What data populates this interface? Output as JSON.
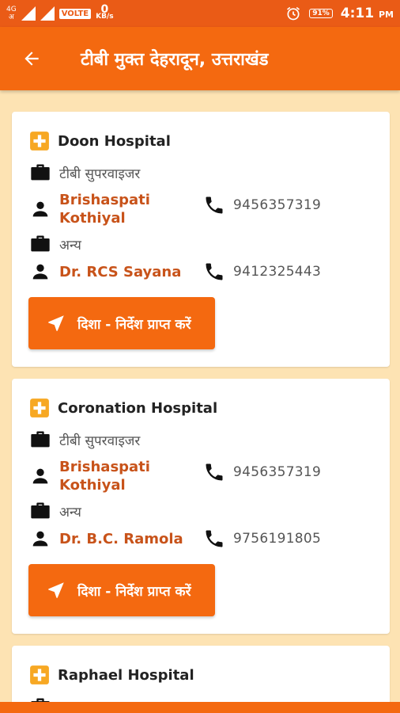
{
  "status_bar": {
    "network": "4G",
    "network_sub": "अ",
    "volte": "VOLTE",
    "data_speed": "0",
    "data_unit": "KB/s",
    "battery": "91%",
    "time": "4:11",
    "ampm": "PM"
  },
  "header": {
    "title": "टीबी मुक्त देहरादून, उत्तराखंड"
  },
  "hospitals": [
    {
      "name": "Doon Hospital",
      "role1": "टीबी सुपरवाइजर",
      "contact1_name": "Brishaspati Kothiyal",
      "contact1_phone": "9456357319",
      "role2": "अन्य",
      "contact2_name": "Dr. RCS Sayana",
      "contact2_phone": "9412325443",
      "button_label": "दिशा - निर्देश प्राप्त करें"
    },
    {
      "name": "Coronation Hospital",
      "role1": "टीबी सुपरवाइजर",
      "contact1_name": "Brishaspati Kothiyal",
      "contact1_phone": "9456357319",
      "role2": "अन्य",
      "contact2_name": "Dr. B.C. Ramola",
      "contact2_phone": "9756191805",
      "button_label": "दिशा - निर्देश प्राप्त करें"
    },
    {
      "name": "Raphael Hospital"
    }
  ],
  "colors": {
    "status_bar": "#ea5b16",
    "app_bar": "#f46910",
    "background": "#fde3b3",
    "name_text": "#c8531a",
    "hospital_icon": "#f7a823"
  }
}
